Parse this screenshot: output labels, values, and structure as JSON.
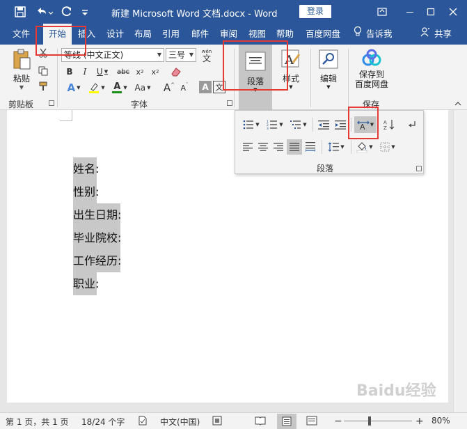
{
  "titlebar": {
    "title": "新建 Microsoft Word 文档.docx  -  Word",
    "login_label": "登录"
  },
  "tabs": [
    {
      "label": "文件"
    },
    {
      "label": "开始"
    },
    {
      "label": "插入"
    },
    {
      "label": "设计"
    },
    {
      "label": "布局"
    },
    {
      "label": "引用"
    },
    {
      "label": "邮件"
    },
    {
      "label": "审阅"
    },
    {
      "label": "视图"
    },
    {
      "label": "帮助"
    },
    {
      "label": "百度网盘"
    }
  ],
  "tell_me": "告诉我",
  "share": "共享",
  "ribbon": {
    "clipboard": {
      "paste_label": "粘贴",
      "group_label": "剪贴板"
    },
    "font": {
      "font_name": "等线 (中文正文)",
      "font_size": "三号",
      "group_label": "字体",
      "wen_label": "wén",
      "wen_char": "文",
      "A_label": "A"
    },
    "paragraph": {
      "button_label": "段落"
    },
    "styles": {
      "button_label": "样式"
    },
    "editing": {
      "button_label": "编辑"
    },
    "save": {
      "button_label_1": "保存到",
      "button_label_2": "百度网盘",
      "group_label": "保存"
    }
  },
  "para_panel": {
    "group_label": "段落"
  },
  "document": {
    "lines": [
      "姓名:",
      "性别:",
      "出生日期:",
      "毕业院校:",
      "工作经历:",
      "职业:"
    ]
  },
  "statusbar": {
    "page": "第 1 页，共 1 页",
    "words": "18/24 个字",
    "language": "中文(中国)",
    "zoom": "80%"
  },
  "watermark": "Baidu经验",
  "colors": {
    "brand": "#2b579a",
    "highlight_box": "#e53935",
    "selection": "#c8c8c8"
  }
}
